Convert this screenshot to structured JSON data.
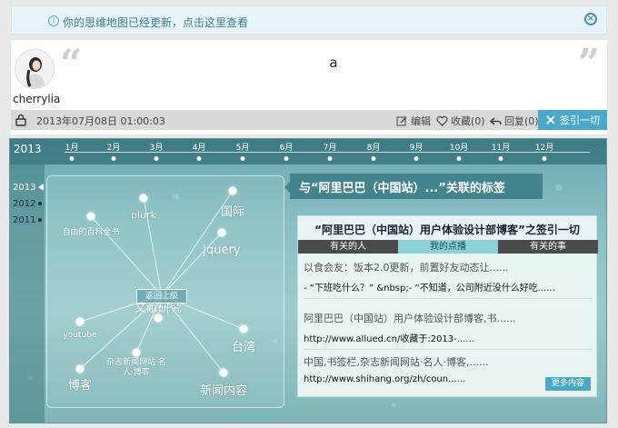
{
  "notice": {
    "text": "你的思维地图已经更新，点击这里查看",
    "info_icon": "info-icon",
    "close_icon": "close-icon"
  },
  "post": {
    "username": "cherrylia",
    "content": "a",
    "timestamp": "2013年07月08日 01:00:03",
    "actions": {
      "edit": "编辑",
      "favorite": "收藏(0)",
      "reply": "回复(0)",
      "mark": "签引一切"
    }
  },
  "timeline": {
    "year": "2013",
    "months": [
      "1月",
      "2月",
      "3月",
      "4月",
      "5月",
      "6月",
      "7月",
      "8月",
      "9月",
      "10月",
      "11月",
      "12月"
    ],
    "years": [
      "2013",
      "2012",
      "2011"
    ],
    "active_year": "2013"
  },
  "mindmap": {
    "back_label": "返回上级",
    "nodes": [
      "plurk",
      "国际",
      "自由的百科全书",
      "jquery",
      "youtube",
      "文献研究",
      "台湾",
      "杂志新闻网站·名人·博客",
      "博客",
      "新闻内容"
    ]
  },
  "tags_panel": {
    "title": "与“阿里巴巴（中国站）...”关联的标签",
    "card_title": "“阿里巴巴（中国站）用户体验设计部博客”之签引一切",
    "tabs": [
      "有关的人",
      "我的点播",
      "有关的事"
    ],
    "active_tab": "我的点播",
    "entries": [
      {
        "title": "以食会友：饭本2.0更新，前置好友动态让......",
        "sub": "- “下班吃什么？” &nbsp;- “不知道，公司附近没什么好吃......"
      },
      {
        "title": "阿里巴巴（中国站）用户体验设计部博客,书......",
        "sub": "http://www.allued.cn/收藏于:2013-......"
      },
      {
        "title": "中国,书签栏,杂志新闻网站·名人·博客,......",
        "sub": "http://www.shihang.org/zh/coun......"
      }
    ],
    "more": "更多内容"
  },
  "colors": {
    "accent": "#4aa9c6",
    "panel_teal": "#89c0c4",
    "notice_bg": "#e6f3f7"
  }
}
